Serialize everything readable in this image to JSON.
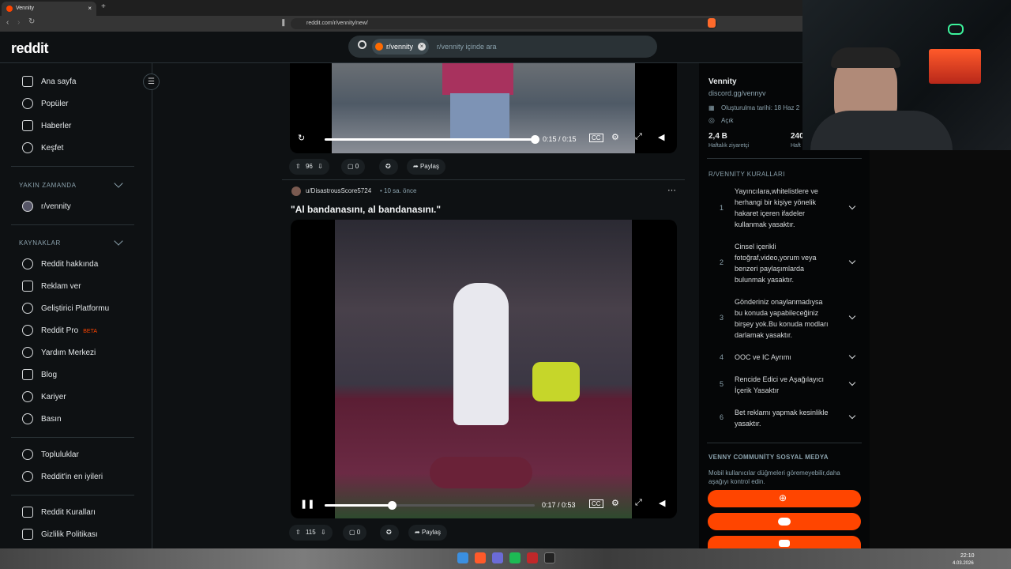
{
  "browser": {
    "tab_title": "Vennity",
    "tab_close": "×",
    "new_tab": "+",
    "url": "reddit.com/r/vennity/new/"
  },
  "header": {
    "logo": "reddit",
    "search_chip": "r/vennity",
    "search_chip_close": "×",
    "search_placeholder": "r/vennity içinde ara"
  },
  "sidebar": {
    "top": [
      {
        "label": "Ana sayfa",
        "icon": "home-icon"
      },
      {
        "label": "Popüler",
        "icon": "popular-icon"
      },
      {
        "label": "Haberler",
        "icon": "news-icon"
      },
      {
        "label": "Keşfet",
        "icon": "explore-icon"
      }
    ],
    "recent_title": "YAKIN ZAMANDA",
    "recent": [
      {
        "label": "r/vennity"
      }
    ],
    "resources_title": "KAYNAKLAR",
    "resources": [
      {
        "label": "Reddit hakkında"
      },
      {
        "label": "Reklam ver"
      },
      {
        "label": "Geliştirici Platformu"
      },
      {
        "label": "Reddit Pro",
        "badge": "BETA"
      },
      {
        "label": "Yardım Merkezi"
      },
      {
        "label": "Blog"
      },
      {
        "label": "Kariyer"
      },
      {
        "label": "Basın"
      }
    ],
    "more": [
      {
        "label": "Topluluklar"
      },
      {
        "label": "Reddit'in en iyileri"
      }
    ],
    "legal": [
      {
        "label": "Reddit Kuralları"
      },
      {
        "label": "Gizlilik Politikası"
      }
    ]
  },
  "posts": [
    {
      "time": "0:15 / 0:15",
      "progress": 1.0,
      "votes": "96",
      "comments": "0",
      "share": "Paylaş"
    },
    {
      "author": "u/DisastrousScore5724",
      "age": "• 10 sa. önce",
      "title": "\"Al bandanasını, al bandanasını.\"",
      "time": "0:17 / 0:53",
      "progress": 0.32,
      "votes": "115",
      "comments": "0",
      "share": "Paylaş"
    }
  ],
  "community": {
    "name": "Vennity",
    "link": "discord.gg/vennyv",
    "created": "Oluşturulma tarihi: 18 Haz 2",
    "visibility": "Açık",
    "stat1_value": "2,4 B",
    "stat1_label": "Haftalık ziyaretçi",
    "stat2_value": "240",
    "stat2_label": "Haft",
    "rules_title": "R/VENNİTY KURALLARI",
    "rules": [
      {
        "n": "1",
        "text": "Yayıncılara,whitelistlere ve herhangi bir kişiye yönelik hakaret içeren ifadeler kullanmak yasaktır."
      },
      {
        "n": "2",
        "text": "Cinsel içerikli fotoğraf,video,yorum veya benzeri paylaşımlarda bulunmak yasaktır."
      },
      {
        "n": "3",
        "text": "Gönderiniz onaylanmadıysa bu konuda yapabileceğiniz birşey yok.Bu konuda modları darlamak yasaktır."
      },
      {
        "n": "4",
        "text": "OOC ve IC Ayrımı"
      },
      {
        "n": "5",
        "text": "Rencide Edici ve Aşağılayıcı İçerik Yasaktır"
      },
      {
        "n": "6",
        "text": "Bet reklamı yapmak kesinlikle yasaktır."
      }
    ],
    "social_title": "VENNY COMMUNİTY SOSYAL MEDYA",
    "social_desc": "Mobil kullanıcılar düğmeleri göremeyebilir,daha aşağıyı kontrol edin."
  },
  "taskbar": {
    "time": "22:10",
    "date": "4.03.2026"
  },
  "colors": {
    "accent": "#ff4500",
    "bg": "#0e1113"
  }
}
